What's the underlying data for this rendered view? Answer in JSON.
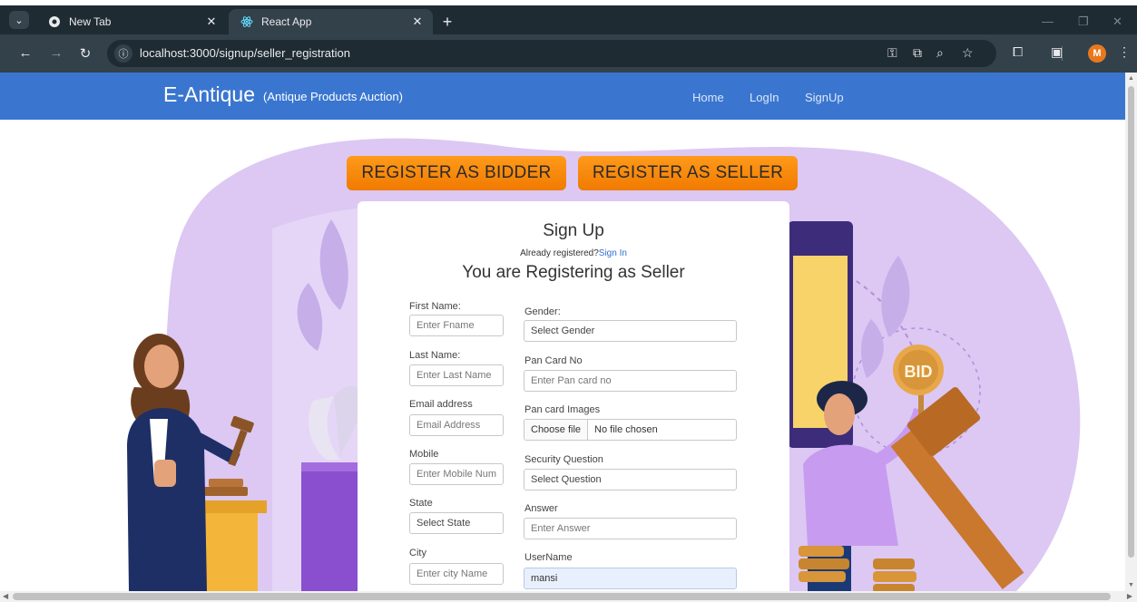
{
  "browser": {
    "tabs": [
      {
        "title": "New Tab",
        "icon": "chrome-icon",
        "active": false
      },
      {
        "title": "React App",
        "icon": "react-icon",
        "active": true
      }
    ],
    "url": "localhost:3000/signup/seller_registration",
    "profile_initial": "M"
  },
  "navbar": {
    "brand": "E-Antique",
    "brand_sub": "(Antique Products Auction)",
    "links": [
      "Home",
      "LogIn",
      "SignUp"
    ]
  },
  "register_buttons": {
    "bidder": "REGISTER AS BIDDER",
    "seller": "REGISTER AS SELLER"
  },
  "art": {
    "bid_sign": "BID"
  },
  "form": {
    "title": "Sign Up",
    "already_text": "Already registered?",
    "signin_link": "Sign In",
    "role_line": "You are Registering as Seller",
    "left": [
      {
        "label": "First Name:",
        "placeholder": "Enter Fname"
      },
      {
        "label": "Last Name:",
        "placeholder": "Enter Last Name"
      },
      {
        "label": "Email address",
        "placeholder": "Email Address"
      },
      {
        "label": "Mobile",
        "placeholder": "Enter Mobile Num"
      },
      {
        "label": "State",
        "placeholder": "Select State"
      },
      {
        "label": "City",
        "placeholder": "Enter city Name"
      }
    ],
    "right": [
      {
        "label": "Gender:",
        "placeholder": "Select Gender"
      },
      {
        "label": "Pan Card No",
        "placeholder": "Enter Pan card no"
      },
      {
        "label": "Pan card Images",
        "file_button": "Choose file",
        "file_status": "No file chosen"
      },
      {
        "label": "Security Question",
        "placeholder": "Select Question"
      },
      {
        "label": "Answer",
        "placeholder": "Enter Answer"
      },
      {
        "label": "UserName",
        "value": "mansi"
      }
    ]
  },
  "colors": {
    "navbar": "#3a76d0",
    "register_button": "#f58a0c",
    "blob": "#d9c4f2",
    "link": "#2f6fd1"
  }
}
